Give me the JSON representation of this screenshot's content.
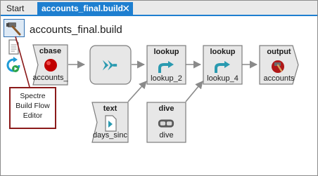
{
  "tabs": {
    "start_label": "Start",
    "active_label": "accounts_final.build",
    "close_glyph": "✕"
  },
  "header": {
    "title": "accounts_final.build"
  },
  "toolbar": {
    "icons": [
      "hammer-icon",
      "document-icon",
      "run-refresh-icon"
    ]
  },
  "nodes": {
    "cbase": {
      "title": "cbase",
      "label": "accounts_"
    },
    "arrow": {
      "title": "",
      "label": ""
    },
    "lookup1": {
      "title": "lookup",
      "label": "lookup_2"
    },
    "lookup2": {
      "title": "lookup",
      "label": "lookup_4"
    },
    "output": {
      "title": "output",
      "label": "accounts"
    },
    "text": {
      "title": "text",
      "label": "days_sinc"
    },
    "dive": {
      "title": "dive",
      "label": "dive"
    }
  },
  "callout": {
    "line1": "Spectre",
    "line2": "Build Flow",
    "line3": "Editor"
  },
  "colors": {
    "tab_active": "#1e7fd0",
    "node_fill": "#e7e7e7",
    "node_border": "#7d7d7d",
    "connector": "#8a8a8a",
    "callout_border": "#8b1a1a",
    "flow_icon": "#2a9ab0",
    "cbase_dot": "#c10000"
  }
}
